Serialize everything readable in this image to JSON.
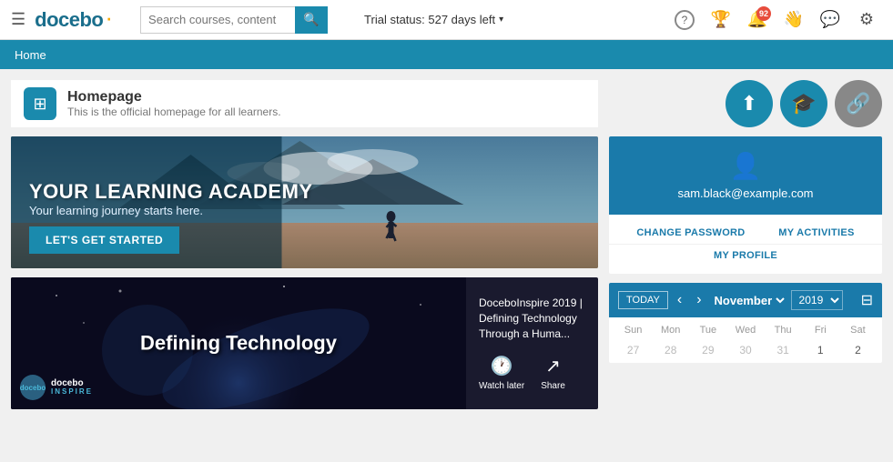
{
  "nav": {
    "logo": "docebo",
    "logo_dot": "·",
    "search_placeholder": "Search courses, content",
    "trial_status": "Trial status: 527 days left",
    "icons": [
      {
        "name": "help",
        "symbol": "?",
        "badge": null
      },
      {
        "name": "trophy",
        "symbol": "🏆",
        "badge": null
      },
      {
        "name": "bell",
        "symbol": "🔔",
        "badge": "92"
      },
      {
        "name": "person-wave",
        "symbol": "👋",
        "badge": null
      },
      {
        "name": "messages",
        "symbol": "💬",
        "badge": null
      },
      {
        "name": "gear",
        "symbol": "⚙",
        "badge": null
      }
    ]
  },
  "breadcrumb": {
    "items": [
      "Home"
    ]
  },
  "page_header": {
    "title": "Homepage",
    "subtitle": "This is the official homepage for all learners.",
    "icon": "⊞"
  },
  "action_buttons": [
    {
      "label": "upload",
      "icon": "⬆"
    },
    {
      "label": "graduate",
      "icon": "🎓"
    },
    {
      "label": "link",
      "icon": "🔗"
    }
  ],
  "hero": {
    "title": "YOUR LEARNING ACADEMY",
    "subtitle": "Your learning journey starts here.",
    "cta": "LET'S GET STARTED"
  },
  "video": {
    "title": "DoceboInspire 2019 | Defining Technology Through a Huma...",
    "short_title": "Defining Technology",
    "watch_later": "Watch later",
    "share": "Share",
    "brand": "docebo",
    "brand_sub": "INSPIRE"
  },
  "user_card": {
    "email": "sam.black@example.com",
    "links": [
      [
        "CHANGE PASSWORD",
        "MY ACTIVITIES"
      ],
      [
        "MY PROFILE"
      ]
    ]
  },
  "calendar": {
    "today_label": "TODAY",
    "month": "November",
    "year": "2019",
    "day_headers": [
      "Sun",
      "Mon",
      "Tue",
      "Wed",
      "Thu",
      "Fri",
      "Sat"
    ],
    "rows": [
      [
        {
          "day": "27",
          "other": true
        },
        {
          "day": "28",
          "other": true
        },
        {
          "day": "29",
          "other": true
        },
        {
          "day": "30",
          "other": true
        },
        {
          "day": "31",
          "other": true
        },
        {
          "day": "1"
        },
        {
          "day": "2"
        }
      ]
    ]
  }
}
